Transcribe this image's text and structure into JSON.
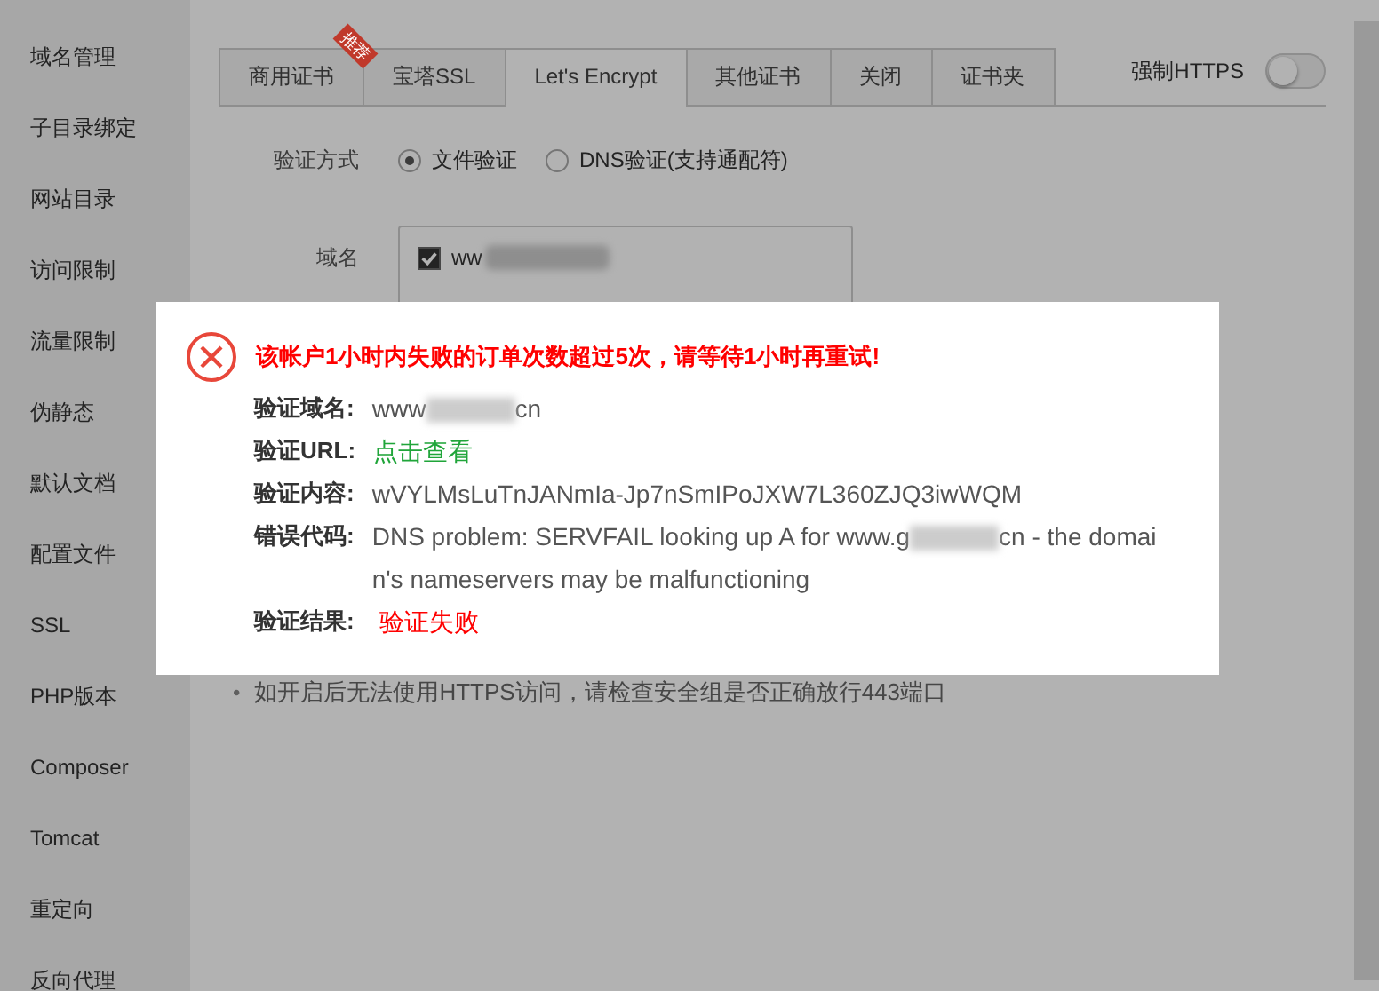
{
  "sidebar": {
    "items": [
      "域名管理",
      "子目录绑定",
      "网站目录",
      "访问限制",
      "流量限制",
      "伪静态",
      "默认文档",
      "配置文件",
      "SSL",
      "PHP版本",
      "Composer",
      "Tomcat",
      "重定向",
      "反向代理"
    ]
  },
  "tabs": [
    {
      "label": "商用证书",
      "selected": false,
      "ribbon": "推荐"
    },
    {
      "label": "宝塔SSL",
      "selected": false
    },
    {
      "label": "Let's Encrypt",
      "selected": true
    },
    {
      "label": "其他证书",
      "selected": false
    },
    {
      "label": "关闭",
      "selected": false
    },
    {
      "label": "证书夹",
      "selected": false
    }
  ],
  "force_https": {
    "label": "强制HTTPS",
    "on": false
  },
  "verify_method": {
    "label": "验证方式",
    "options": [
      {
        "label": "文件验证",
        "selected": true
      },
      {
        "label": "DNS验证(支持通配符)",
        "selected": false
      }
    ]
  },
  "domain": {
    "label": "域名",
    "items": [
      {
        "prefix": "ww",
        "checked": true
      }
    ]
  },
  "notes": [
    {
      "bullet": "•",
      "text": "如开启后无法使用HTTPS访问，请检查安全组是否正确放行443端口"
    }
  ],
  "dialog": {
    "title": "该帐户1小时内失败的订单次数超过5次，请等待1小时再重试!",
    "rows": [
      {
        "kind": "masked",
        "label": "验证域名:",
        "before": "www",
        "after": "cn"
      },
      {
        "kind": "link",
        "label": "验证URL:",
        "value": "点击查看"
      },
      {
        "kind": "text",
        "label": "验证内容:",
        "value": "wVYLMsLuTnJANmIa-Jp7nSmIPoJXW7L360ZJQ3iwWQM"
      },
      {
        "kind": "masked",
        "label": "错误代码:",
        "before": "DNS problem: SERVFAIL looking up A for www.g",
        "after": "cn - the domain's nameservers may be malfunctioning"
      },
      {
        "kind": "error",
        "label": "验证结果:",
        "value": "验证失败"
      }
    ]
  }
}
